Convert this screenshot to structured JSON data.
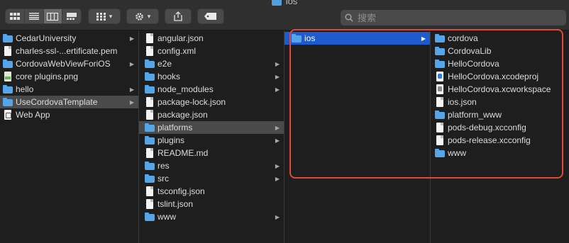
{
  "window": {
    "title": "ios"
  },
  "toolbar": {
    "view_modes": [
      "icon-view",
      "list-view",
      "column-view",
      "gallery-view"
    ],
    "active_view": "column-view",
    "group_menu_icon": "grid-icon",
    "action_menu_icon": "gear-icon",
    "share_icon": "share-icon",
    "tag_icon": "tag-icon",
    "chevron": "▾"
  },
  "search": {
    "placeholder": "搜索"
  },
  "columns": [
    {
      "items": [
        {
          "label": "CedarUniversity",
          "icon": "folder",
          "has_children": true
        },
        {
          "label": "charles-ssl-...ertificate.pem",
          "icon": "doc",
          "has_children": false
        },
        {
          "label": "CordovaWebViewForiOS",
          "icon": "folder",
          "has_children": true
        },
        {
          "label": "core plugins.png",
          "icon": "img",
          "has_children": false
        },
        {
          "label": "hello",
          "icon": "folder",
          "has_children": true
        },
        {
          "label": "UseCordovaTemplate",
          "icon": "folder",
          "has_children": true,
          "selected": "gray"
        },
        {
          "label": "Web App",
          "icon": "app",
          "has_children": false
        }
      ]
    },
    {
      "items": [
        {
          "label": "angular.json",
          "icon": "doc",
          "has_children": false
        },
        {
          "label": "config.xml",
          "icon": "doc",
          "has_children": false
        },
        {
          "label": "e2e",
          "icon": "folder",
          "has_children": true
        },
        {
          "label": "hooks",
          "icon": "folder",
          "has_children": true
        },
        {
          "label": "node_modules",
          "icon": "folder",
          "has_children": true
        },
        {
          "label": "package-lock.json",
          "icon": "doc",
          "has_children": false
        },
        {
          "label": "package.json",
          "icon": "doc",
          "has_children": false
        },
        {
          "label": "platforms",
          "icon": "folder",
          "has_children": true,
          "selected": "gray"
        },
        {
          "label": "plugins",
          "icon": "folder",
          "has_children": true
        },
        {
          "label": "README.md",
          "icon": "doc",
          "has_children": false
        },
        {
          "label": "res",
          "icon": "folder",
          "has_children": true
        },
        {
          "label": "src",
          "icon": "folder",
          "has_children": true
        },
        {
          "label": "tsconfig.json",
          "icon": "doc",
          "has_children": false
        },
        {
          "label": "tslint.json",
          "icon": "doc",
          "has_children": false
        },
        {
          "label": "www",
          "icon": "folder",
          "has_children": true
        }
      ]
    },
    {
      "items": [
        {
          "label": "ios",
          "icon": "folder",
          "has_children": true,
          "selected": "blue"
        }
      ]
    },
    {
      "items": [
        {
          "label": "cordova",
          "icon": "folder",
          "has_children": false
        },
        {
          "label": "CordovaLib",
          "icon": "folder",
          "has_children": false
        },
        {
          "label": "HelloCordova",
          "icon": "folder",
          "has_children": false
        },
        {
          "label": "HelloCordova.xcodeproj",
          "icon": "xcproj",
          "has_children": false
        },
        {
          "label": "HelloCordova.xcworkspace",
          "icon": "xcws",
          "has_children": false
        },
        {
          "label": "ios.json",
          "icon": "doc",
          "has_children": false
        },
        {
          "label": "platform_www",
          "icon": "folder",
          "has_children": false
        },
        {
          "label": "pods-debug.xcconfig",
          "icon": "doc",
          "has_children": false
        },
        {
          "label": "pods-release.xcconfig",
          "icon": "doc",
          "has_children": false
        },
        {
          "label": "www",
          "icon": "folder",
          "has_children": false
        }
      ]
    }
  ],
  "colors": {
    "selection_blue": "#1c5bd0",
    "selection_gray": "#4a4a4a",
    "folder_blue": "#55a6e8",
    "annotation_red": "#e0483a"
  }
}
